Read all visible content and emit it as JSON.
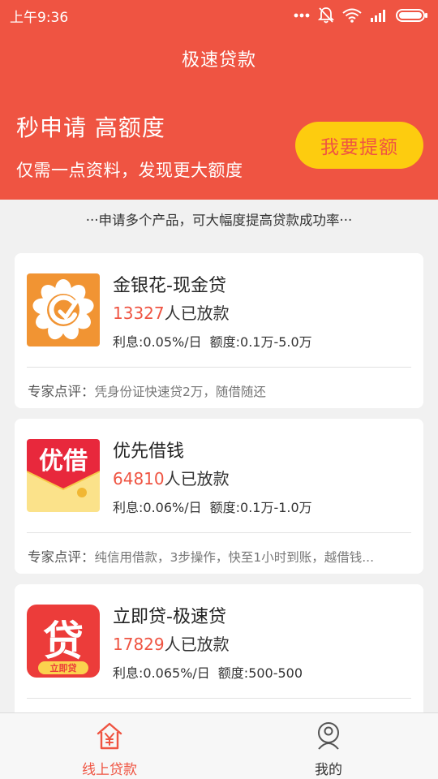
{
  "status_bar": {
    "time": "上午9:36",
    "icons": [
      "more-dots-icon",
      "bell-off-icon",
      "wifi-icon",
      "signal-icon",
      "battery-icon"
    ]
  },
  "header": {
    "title": "极速贷款",
    "promo_title": "秒申请 高额度",
    "promo_subtitle": "仅需一点资料，发现更大额度",
    "raise_button": "我要提额"
  },
  "tip": "···申请多个产品，可大幅度提高贷款成功率···",
  "products": [
    {
      "name": "金银花-现金贷",
      "count": "13327",
      "count_suffix": "人已放款",
      "rate": "利息:0.05%/日",
      "limit": "额度:0.1万-5.0万",
      "review_label": "专家点评：",
      "review": "凭身份证快速贷2万，随借随还",
      "logo": "jinyinhua-logo"
    },
    {
      "name": "优先借钱",
      "count": "64810",
      "count_suffix": "人已放款",
      "rate": "利息:0.06%/日",
      "limit": "额度:0.1万-1.0万",
      "review_label": "专家点评：",
      "review": "纯信用借款，3步操作，快至1小时到账，越借钱...",
      "logo": "youjie-logo",
      "logo_text": "优借"
    },
    {
      "name": "立即贷-极速贷",
      "count": "17829",
      "count_suffix": "人已放款",
      "rate": "利息:0.065%/日",
      "limit": "额度:500-500",
      "logo": "lijidai-logo",
      "logo_text": "贷",
      "logo_sub": "立即贷"
    }
  ],
  "tabs": [
    {
      "label": "线上贷款",
      "icon": "loan-house-icon",
      "active": true
    },
    {
      "label": "我的",
      "icon": "profile-icon",
      "active": false
    }
  ],
  "colors": {
    "brand": "#ef5442",
    "button": "#fdcc0f",
    "active_tab": "#ef5442"
  }
}
